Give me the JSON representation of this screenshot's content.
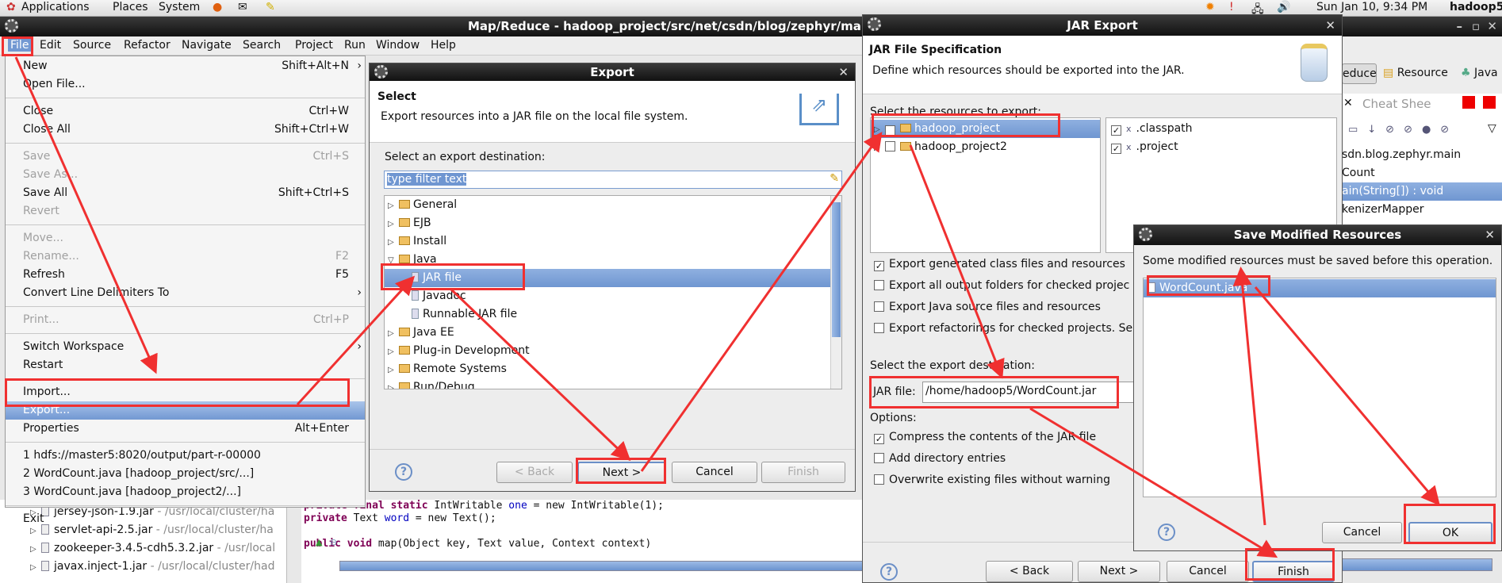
{
  "top_panel": {
    "applications": "Applications",
    "places": "Places",
    "system": "System",
    "clock": "Sun Jan 10,  9:34 PM",
    "user": "hadoop5"
  },
  "eclipse": {
    "title": "Map/Reduce - hadoop_project/src/net/csdn/blog/zephyr/main/W",
    "menubar": [
      "File",
      "Edit",
      "Source",
      "Refactor",
      "Navigate",
      "Search",
      "Project",
      "Run",
      "Window",
      "Help"
    ],
    "perspectives": [
      "educe",
      "Resource",
      "Java"
    ],
    "outline_tab": "Cheat Shee",
    "outline_rows": [
      "sdn.blog.zephyr.main",
      "Count",
      "ain(String[]) : void",
      "kenizerMapper"
    ],
    "package_rows": [
      {
        "name": "jersey-json-1.9.jar",
        "path": " - /usr/local/cluster/ha"
      },
      {
        "name": "servlet-api-2.5.jar",
        "path": " - /usr/local/cluster/ha"
      },
      {
        "name": "zookeeper-3.4.5-cdh5.3.2.jar",
        "path": " - /usr/local"
      },
      {
        "name": "javax.inject-1.jar",
        "path": " - /usr/local/cluster/had"
      }
    ],
    "code": [
      {
        "kw": "private final static ",
        "rest": "IntWritable ",
        "fld": "one",
        "tail": " = new IntWritable(1);"
      },
      {
        "kw": "private ",
        "rest": "Text ",
        "fld": "word",
        "tail": " = new Text();"
      },
      {
        "kw": "",
        "rest": "",
        "fld": "",
        "tail": ""
      },
      {
        "kw": "public void ",
        "rest": "map(Object key, Text value, Context context)",
        "fld": "",
        "tail": ""
      }
    ]
  },
  "file_menu": [
    {
      "label": "New",
      "shortcut": "Shift+Alt+N",
      "submenu": true
    },
    {
      "label": "Open File..."
    },
    {
      "sep": true
    },
    {
      "label": "Close",
      "shortcut": "Ctrl+W"
    },
    {
      "label": "Close All",
      "shortcut": "Shift+Ctrl+W"
    },
    {
      "sep": true
    },
    {
      "label": "Save",
      "shortcut": "Ctrl+S",
      "disabled": true
    },
    {
      "label": "Save As...",
      "disabled": true
    },
    {
      "label": "Save All",
      "shortcut": "Shift+Ctrl+S"
    },
    {
      "label": "Revert",
      "disabled": true
    },
    {
      "sep": true
    },
    {
      "label": "Move...",
      "disabled": true
    },
    {
      "label": "Rename...",
      "shortcut": "F2",
      "disabled": true
    },
    {
      "label": "Refresh",
      "shortcut": "F5"
    },
    {
      "label": "Convert Line Delimiters To",
      "submenu": true
    },
    {
      "sep": true
    },
    {
      "label": "Print...",
      "shortcut": "Ctrl+P",
      "disabled": true
    },
    {
      "sep": true
    },
    {
      "label": "Switch Workspace",
      "submenu": true
    },
    {
      "label": "Restart"
    },
    {
      "sep": true
    },
    {
      "label": "Import..."
    },
    {
      "label": "Export...",
      "highlighted": true
    },
    {
      "label": "Properties",
      "shortcut": "Alt+Enter"
    },
    {
      "sep": true
    },
    {
      "label": "1 hdfs://master5:8020/output/part-r-00000"
    },
    {
      "label": "2 WordCount.java  [hadoop_project/src/...]"
    },
    {
      "label": "3 WordCount.java  [hadoop_project2/...]"
    },
    {
      "sep": true
    },
    {
      "label": "Exit"
    }
  ],
  "export_dialog": {
    "title": "Export",
    "heading": "Select",
    "description": "Export resources into a JAR file on the local file system.",
    "dest_label": "Select an export destination:",
    "filter_value": "type filter text",
    "tree": [
      {
        "label": "General",
        "type": "folder",
        "state": "collapsed"
      },
      {
        "label": "EJB",
        "type": "folder",
        "state": "collapsed"
      },
      {
        "label": "Install",
        "type": "folder",
        "state": "collapsed"
      },
      {
        "label": "Java",
        "type": "folder",
        "state": "expanded"
      },
      {
        "label": "JAR file",
        "type": "item",
        "selected": true
      },
      {
        "label": "Javadoc",
        "type": "item"
      },
      {
        "label": "Runnable JAR file",
        "type": "item"
      },
      {
        "label": "Java EE",
        "type": "folder",
        "state": "collapsed"
      },
      {
        "label": "Plug-in Development",
        "type": "folder",
        "state": "collapsed"
      },
      {
        "label": "Remote Systems",
        "type": "folder",
        "state": "collapsed"
      },
      {
        "label": "Run/Debug",
        "type": "folder",
        "state": "collapsed"
      }
    ],
    "buttons": {
      "back": "< Back",
      "next": "Next >",
      "cancel": "Cancel",
      "finish": "Finish"
    }
  },
  "jar_dialog": {
    "title": "JAR Export",
    "heading": "JAR File Specification",
    "description": "Define which resources should be exported into the JAR.",
    "resources_label": "Select the resources to export:",
    "projects": [
      {
        "label": "hadoop_project",
        "checked": true,
        "selected": true
      },
      {
        "label": "hadoop_project2",
        "checked": false
      }
    ],
    "files": [
      {
        "label": ".classpath",
        "checked": true
      },
      {
        "label": ".project",
        "checked": true
      }
    ],
    "export_options": [
      {
        "label": "Export generated class files and resources",
        "checked": true
      },
      {
        "label": "Export all output folders for checked projec",
        "checked": false
      },
      {
        "label": "Export Java source files and resources",
        "checked": false
      },
      {
        "label": "Export refactorings for checked projects. Se",
        "checked": false
      }
    ],
    "dest_label": "Select the export destination:",
    "jar_file_label": "JAR file:",
    "jar_file_value": "/home/hadoop5/WordCount.jar",
    "options_label": "Options:",
    "options": [
      {
        "label": "Compress the contents of the JAR file",
        "checked": true
      },
      {
        "label": "Add directory entries",
        "checked": false
      },
      {
        "label": "Overwrite existing files without warning",
        "checked": false
      }
    ],
    "buttons": {
      "back": "< Back",
      "next": "Next >",
      "cancel": "Cancel",
      "finish": "Finish"
    }
  },
  "save_dialog": {
    "title": "Save Modified Resources",
    "message": "Some modified resources must be saved before this operation.",
    "items": [
      "WordCount.java"
    ],
    "buttons": {
      "cancel": "Cancel",
      "ok": "OK"
    }
  },
  "colors": {
    "annotation": "#f03030",
    "selection": "#7298d2",
    "titlebar": "#1a1a1a"
  }
}
